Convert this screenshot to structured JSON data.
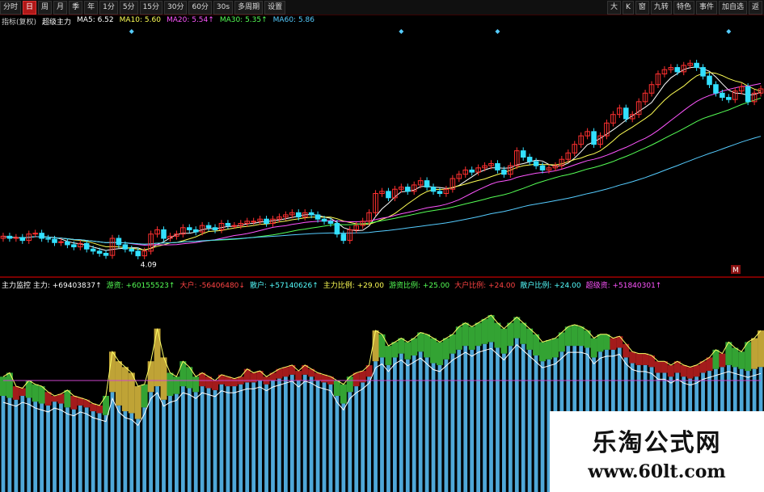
{
  "toolbar": {
    "left": [
      "分时",
      "日",
      "周",
      "月",
      "季",
      "年",
      "1分",
      "5分",
      "15分",
      "30分",
      "60分",
      "30s",
      "多周期",
      "设置"
    ],
    "active_index": 1,
    "right": [
      "大",
      "K",
      "窗",
      "九转",
      "特色",
      "事件",
      "加自选",
      "返"
    ]
  },
  "price_legend": [
    {
      "label": "指标(复权)",
      "color": "#cccccc"
    },
    {
      "label": "超级主力",
      "color": "#ffffff"
    },
    {
      "label": "MA5: 6.52",
      "color": "#ffffff"
    },
    {
      "label": "MA10: 5.60",
      "color": "#ffff55"
    },
    {
      "label": "MA20: 5.54↑",
      "color": "#ff55ff"
    },
    {
      "label": "MA30: 5.35↑",
      "color": "#55ff55"
    },
    {
      "label": "MA60: 5.86",
      "color": "#55ccff"
    }
  ],
  "price_low_label": "4.09",
  "price_marker": "M",
  "indicator_legend": [
    {
      "label": "主力监控 主力: +69403837↑",
      "color": "#ffffff"
    },
    {
      "label": "游资: +60155523↑",
      "color": "#55ff55"
    },
    {
      "label": "大户: -56406480↓",
      "color": "#ff4444"
    },
    {
      "label": "散户: +57140626↑",
      "color": "#55ffff"
    },
    {
      "label": "主力比例: +29.00",
      "color": "#ffff55"
    },
    {
      "label": "游资比例: +25.00",
      "color": "#55ff55"
    },
    {
      "label": "大户比例: +24.00",
      "color": "#ff4444"
    },
    {
      "label": "散户比例: +24.00",
      "color": "#55ffff"
    },
    {
      "label": "超级资: +51840301↑",
      "color": "#ff55ff"
    }
  ],
  "watermark": {
    "title": "乐淘公式网",
    "url": "www.60lt.com"
  },
  "chart_data": [
    {
      "type": "candlestick",
      "panel": "price",
      "title": "",
      "ylim": [
        3.8,
        9.4
      ],
      "close": [
        4.55,
        4.5,
        4.52,
        4.45,
        4.6,
        4.62,
        4.5,
        4.48,
        4.4,
        4.42,
        4.35,
        4.3,
        4.38,
        4.25,
        4.2,
        4.15,
        4.1,
        4.5,
        4.35,
        4.25,
        4.2,
        4.09,
        4.2,
        4.6,
        4.7,
        4.5,
        4.55,
        4.6,
        4.75,
        4.7,
        4.65,
        4.8,
        4.75,
        4.7,
        4.85,
        4.8,
        4.8,
        4.85,
        4.9,
        4.9,
        4.95,
        4.85,
        4.95,
        5.0,
        5.05,
        5.1,
        5.0,
        5.1,
        5.05,
        4.95,
        4.9,
        4.85,
        4.6,
        4.45,
        4.7,
        4.8,
        4.9,
        5.1,
        5.55,
        5.6,
        5.45,
        5.65,
        5.7,
        5.6,
        5.75,
        5.85,
        5.7,
        5.6,
        5.55,
        5.65,
        5.9,
        6.0,
        6.1,
        6.05,
        6.15,
        6.2,
        6.25,
        6.1,
        6.0,
        6.2,
        6.55,
        6.4,
        6.3,
        6.2,
        6.1,
        6.15,
        6.2,
        6.35,
        6.5,
        6.7,
        6.9,
        7.0,
        6.7,
        6.9,
        7.2,
        7.4,
        7.55,
        7.3,
        7.4,
        7.7,
        7.9,
        8.1,
        8.35,
        8.45,
        8.5,
        8.4,
        8.55,
        8.6,
        8.5,
        8.3,
        8.1,
        7.9,
        7.8,
        7.75,
        7.95,
        8.05,
        7.7,
        7.9,
        8.0
      ],
      "series": [
        {
          "name": "MA5",
          "color": "#ffffff"
        },
        {
          "name": "MA10",
          "color": "#ffff55"
        },
        {
          "name": "MA20",
          "color": "#ff55ff"
        },
        {
          "name": "MA30",
          "color": "#55ff55"
        },
        {
          "name": "MA60",
          "color": "#55ccff"
        }
      ],
      "diamond_markers_at_index": [
        20,
        62,
        77,
        113
      ]
    },
    {
      "type": "bar",
      "panel": "indicator",
      "title": "",
      "ylim": [
        0,
        100
      ],
      "values_散户": [
        50,
        49,
        48,
        50,
        49,
        47,
        46,
        45,
        47,
        46,
        44,
        43,
        45,
        44,
        42,
        41,
        40,
        52,
        45,
        42,
        41,
        38,
        44,
        52,
        55,
        48,
        50,
        51,
        55,
        54,
        52,
        55,
        54,
        53,
        56,
        55,
        55,
        56,
        57,
        57,
        58,
        56,
        58,
        59,
        60,
        61,
        58,
        61,
        60,
        58,
        57,
        56,
        50,
        46,
        52,
        55,
        57,
        60,
        68,
        70,
        66,
        70,
        72,
        69,
        71,
        73,
        70,
        67,
        66,
        69,
        72,
        74,
        76,
        74,
        76,
        77,
        78,
        75,
        72,
        76,
        80,
        77,
        74,
        71,
        68,
        69,
        70,
        73,
        76,
        76,
        76,
        75,
        70,
        73,
        74,
        74,
        75,
        70,
        67,
        66,
        66,
        65,
        62,
        62,
        60,
        62,
        60,
        59,
        60,
        62,
        63,
        64,
        65,
        66,
        65,
        64,
        63,
        64,
        65
      ],
      "values_主力": [
        60,
        62,
        55,
        54,
        58,
        56,
        55,
        52,
        50,
        51,
        53,
        50,
        49,
        48,
        46,
        45,
        50,
        73,
        68,
        65,
        62,
        55,
        56,
        68,
        85,
        70,
        62,
        60,
        68,
        65,
        60,
        62,
        60,
        58,
        61,
        60,
        59,
        60,
        64,
        62,
        63,
        60,
        62,
        64,
        65,
        66,
        63,
        66,
        64,
        62,
        61,
        60,
        58,
        56,
        60,
        62,
        63,
        66,
        84,
        82,
        76,
        78,
        80,
        78,
        80,
        83,
        82,
        80,
        78,
        80,
        82,
        86,
        88,
        86,
        88,
        90,
        92,
        88,
        85,
        88,
        91,
        88,
        85,
        82,
        78,
        79,
        80,
        83,
        86,
        87,
        86,
        84,
        80,
        82,
        82,
        80,
        81,
        77,
        73,
        72,
        72,
        71,
        68,
        68,
        66,
        68,
        66,
        65,
        66,
        68,
        70,
        74,
        72,
        78,
        75,
        73,
        78,
        80,
        84
      ]
    }
  ]
}
